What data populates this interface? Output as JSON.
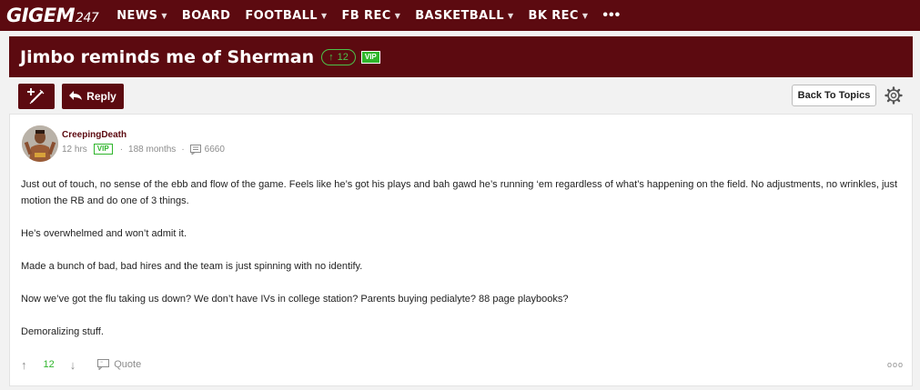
{
  "brand": {
    "name": "GIGEM",
    "number": "247"
  },
  "nav": {
    "items": [
      {
        "label": "NEWS",
        "dropdown": true
      },
      {
        "label": "BOARD",
        "dropdown": false
      },
      {
        "label": "FOOTBALL",
        "dropdown": true
      },
      {
        "label": "FB REC",
        "dropdown": true
      },
      {
        "label": "BASKETBALL",
        "dropdown": true
      },
      {
        "label": "BK REC",
        "dropdown": true
      }
    ],
    "more_label": "•••"
  },
  "thread": {
    "title": "Jimbo reminds me of Sherman",
    "vote_count": "12",
    "vip_label": "VIP"
  },
  "toolbar": {
    "reply_label": "Reply",
    "back_label": "Back To Topics"
  },
  "post": {
    "username": "CreepingDeath",
    "time": "12 hrs",
    "vip_label": "VIP",
    "tenure": "188 months",
    "post_count": "6660",
    "paragraphs": [
      "Just out of touch, no sense of the ebb and flow of the game. Feels like he’s got his plays and bah gawd he’s running ‘em regardless of what’s happening on the field. No adjustments, no wrinkles, just motion the RB and do one of 3 things.",
      "He’s overwhelmed and won’t admit it.",
      "Made a bunch of bad, bad hires and the team is just spinning with no identify.",
      "Now we’ve got the flu taking us down? We don’t have IVs in college station? Parents buying pedialyte? 88 page playbooks?",
      "Demoralizing stuff."
    ],
    "vote_count": "12",
    "quote_label": "Quote",
    "more_label": "ooo"
  },
  "colors": {
    "brand_maroon": "#5c0a10",
    "vip_green": "#2fb52b"
  }
}
